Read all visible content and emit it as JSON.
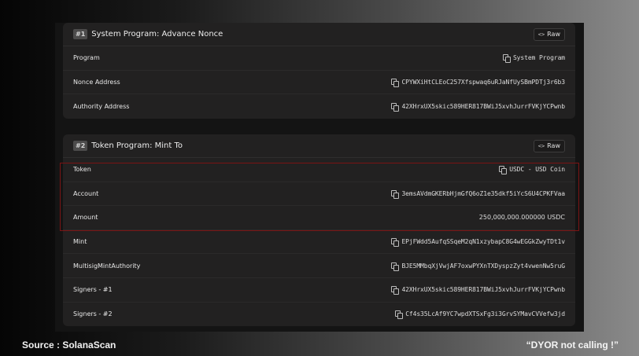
{
  "instructions": [
    {
      "badge": "#1",
      "title": "System Program: Advance Nonce",
      "raw_label": "Raw",
      "rows": [
        {
          "label": "Program",
          "value": "System Program"
        },
        {
          "label": "Nonce Address",
          "value": "CPYWXiHtCLEoC257Xfspwaq6uRJaNfUySBmPDTj3r6b3"
        },
        {
          "label": "Authority Address",
          "value": "42XHrxUX5skic589HER817BWiJ5xvhJurrFVKjYCPwnb"
        }
      ]
    },
    {
      "badge": "#2",
      "title": "Token Program: Mint To",
      "raw_label": "Raw",
      "rows": [
        {
          "label": "Token",
          "value": "USDC - USD Coin"
        },
        {
          "label": "Account",
          "value": "3emsAVdmGKERbHjmGfQ6oZ1e35dkf5iYcS6U4CPKFVaa"
        },
        {
          "label": "Amount",
          "value": "250,000,000.000000 USDC"
        },
        {
          "label": "Mint",
          "value": "EPjFWdd5AufqSSqeM2qN1xzybapC8G4wEGGkZwyTDt1v"
        },
        {
          "label": "MultisigMintAuthority",
          "value": "BJE5MMbqXjVwjAF7oxwPYXnTXDyspzZyt4vwenNw5ruG"
        },
        {
          "label": "Signers - #1",
          "value": "42XHrxUX5skic589HER817BWiJ5xvhJurrFVKjYCPwnb"
        },
        {
          "label": "Signers - #2",
          "value": "Cf4s35LcAf9YC7wpdXTSxFg3i3GrvSYMavCVVefw3jd"
        }
      ]
    }
  ],
  "footer": {
    "source": "Source : SolanaScan",
    "disclaimer": "“DYOR  not calling !”"
  },
  "colors": {
    "highlight_border": "#7a1414",
    "card_bg": "#222121",
    "frame_bg": "#141414"
  },
  "icons": {
    "copy": "copy-icon",
    "raw": "code-icon"
  }
}
